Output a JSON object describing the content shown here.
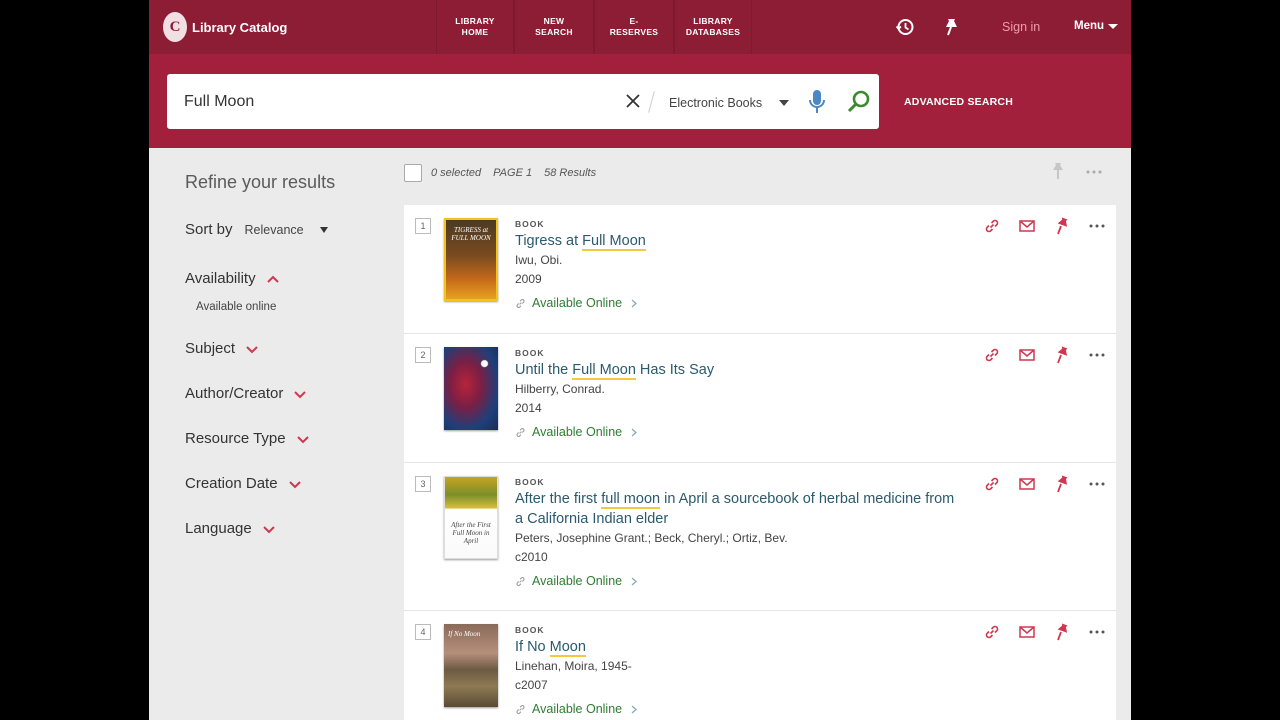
{
  "header": {
    "logo_mark": "C",
    "logo_text": "Library Catalog",
    "nav": [
      {
        "label": "LIBRARY\nHOME"
      },
      {
        "label": "NEW SEARCH"
      },
      {
        "label": "E-RESERVES"
      },
      {
        "label": "LIBRARY\nDATABASES"
      }
    ],
    "sign_in": "Sign in",
    "menu": "Menu"
  },
  "search": {
    "query": "Full Moon",
    "scope": "Electronic Books",
    "advanced": "ADVANCED SEARCH"
  },
  "sidebar": {
    "title": "Refine your results",
    "sort_label": "Sort by",
    "sort_value": "Relevance",
    "facets": [
      "Availability",
      "Subject",
      "Author/Creator",
      "Resource Type",
      "Creation Date",
      "Language"
    ],
    "availability_option": "Available online"
  },
  "toolbar": {
    "selected": "0 selected",
    "page": "PAGE 1",
    "count": "58 Results"
  },
  "results": [
    {
      "num": "1",
      "type": "BOOK",
      "title_pre": "Tigress at ",
      "title_hl": "Full Moon",
      "title_post": "",
      "title_hl2": "",
      "title_post2": "",
      "author": "Iwu, Obi.",
      "date": "2009",
      "availability": "Available Online",
      "cover_text": "TIGRESS at FULL MOON"
    },
    {
      "num": "2",
      "type": "BOOK",
      "title_pre": "Until the ",
      "title_hl": "Full Moon",
      "title_post": " Has Its Say",
      "title_hl2": "",
      "title_post2": "",
      "author": "Hilberry, Conrad.",
      "date": "2014",
      "availability": "Available Online",
      "cover_text": ""
    },
    {
      "num": "3",
      "type": "BOOK",
      "title_pre": "After the first ",
      "title_hl": "full moon",
      "title_post": " in April a sourcebook of herbal medicine from a California Indian elder",
      "title_hl2": "",
      "title_post2": "",
      "author": "Peters, Josephine Grant.; Beck, Cheryl.; Ortiz, Bev.",
      "date": "c2010",
      "availability": "Available Online",
      "cover_text": "After the First Full Moon in April"
    },
    {
      "num": "4",
      "type": "BOOK",
      "title_pre": "If No ",
      "title_hl": "Moon",
      "title_post": "",
      "title_hl2": "",
      "title_post2": "",
      "author": "Linehan, Moira, 1945-",
      "date": "c2007",
      "availability": "Available Online",
      "cover_text": "If No Moon"
    }
  ],
  "colors": {
    "header_dark": "#8c1d35",
    "header": "#a3203d",
    "accent_red": "#d0374f",
    "link": "#2a5a6e",
    "available": "#2e7d32"
  }
}
